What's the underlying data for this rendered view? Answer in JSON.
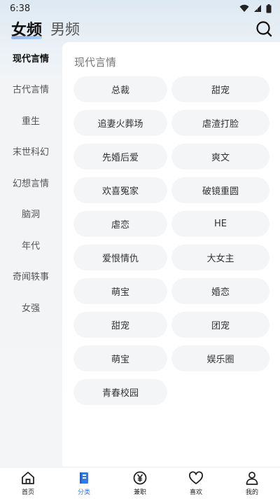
{
  "status_bar": {
    "time": "6:38"
  },
  "header": {
    "tab_female": "女频",
    "tab_male": "男频"
  },
  "sidebar": {
    "items": [
      {
        "label": "现代言情"
      },
      {
        "label": "古代言情"
      },
      {
        "label": "重生"
      },
      {
        "label": "末世科幻"
      },
      {
        "label": "幻想言情"
      },
      {
        "label": "脑洞"
      },
      {
        "label": "年代"
      },
      {
        "label": "奇闻轶事"
      },
      {
        "label": "女强"
      }
    ],
    "active_index": 0
  },
  "panel": {
    "title": "现代言情",
    "tags": [
      "总裁",
      "甜宠",
      "追妻火葬场",
      "虐渣打脸",
      "先婚后爱",
      "爽文",
      "欢喜冤家",
      "破镜重圆",
      "虐恋",
      "HE",
      "爱恨情仇",
      "大女主",
      "萌宝",
      "婚恋",
      "甜宠",
      "团宠",
      "萌宝",
      "娱乐圈",
      "青春校园"
    ]
  },
  "bottom_nav": {
    "items": [
      {
        "label": "首页",
        "icon": "home-icon"
      },
      {
        "label": "分类",
        "icon": "category-icon"
      },
      {
        "label": "兼职",
        "icon": "yen-icon"
      },
      {
        "label": "喜欢",
        "icon": "heart-icon"
      },
      {
        "label": "我的",
        "icon": "user-icon"
      }
    ],
    "active_index": 1
  },
  "colors": {
    "accent": "#2d7bf3",
    "tag_bg": "#f3f5f7",
    "panel_bg": "#ffffff"
  }
}
